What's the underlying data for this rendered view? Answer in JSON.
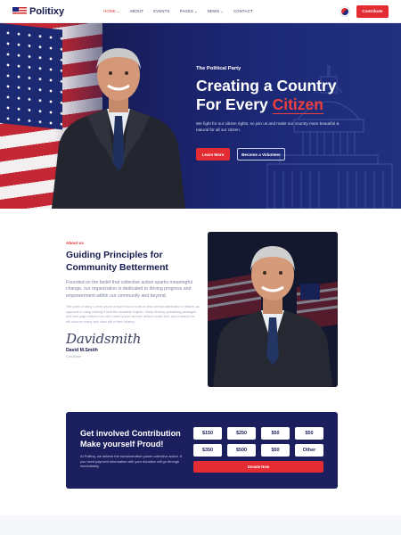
{
  "nav": {
    "logo": "Politixy",
    "items": [
      "HOME",
      "ABOUT",
      "EVENTS",
      "PAGES",
      "NEWS",
      "CONTACT"
    ],
    "cta": "Contribute"
  },
  "hero": {
    "eyebrow": "The Political Party",
    "title_line1": "Creating a Country",
    "title_line2_prefix": "For Every ",
    "title_highlight": "Citizen",
    "description": "We fight for our citizen rights, so join us and make our country more beautiful & natural for all our citizen.",
    "btn_learn": "Learn More",
    "btn_volunteer": "Become a Volunteer"
  },
  "about": {
    "eyebrow": "About us",
    "title": "Guiding Principles for Community Betterment",
    "lead": "Founded on the belief that collective action sparks meaningful change, our organization is dedicated to driving progress and empowerment within our community and beyond.",
    "body": "The point of using Lorem Ipsum is that it has a more-or-less normal distribution of letters, as opposed to using making it look like readable English. Many desktop publishing packages and web page editors now use Lorem Ipsum as their default model text, and a search for will uncover many web sites still in their infancy.",
    "signature": "Davidsmith",
    "name": "David M.Smith",
    "role": "Candidate"
  },
  "donate": {
    "title": "Get involved Contribution Make yourself Proud!",
    "description": "At Politixy, we believe the transformative power collective action. If you need payment information with your donation will go through immediately.",
    "amounts": [
      "$150",
      "$250",
      "$50",
      "$50",
      "$350",
      "$500",
      "$50",
      "Other"
    ],
    "button": "Donate Now"
  },
  "colors": {
    "accent": "#e32d33",
    "navy": "#1b1f5e"
  }
}
